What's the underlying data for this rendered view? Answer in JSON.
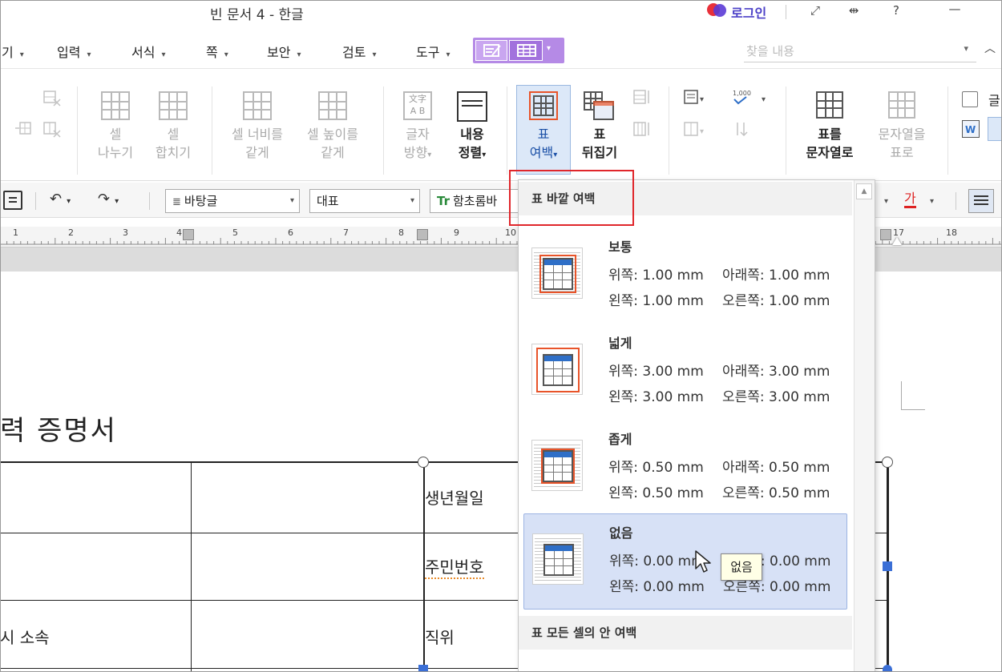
{
  "window": {
    "title": "빈 문서 4 - 한글",
    "login_label": "로그인",
    "icons": [
      "fullscreen-icon",
      "resize-icon",
      "help-icon",
      "minimize-icon"
    ]
  },
  "menu": {
    "items": [
      {
        "label": "기",
        "caret": "▾"
      },
      {
        "label": "입력",
        "caret": "▾"
      },
      {
        "label": "서식",
        "caret": "▾"
      },
      {
        "label": "쪽",
        "caret": "▾"
      },
      {
        "label": "보안",
        "caret": "▾"
      },
      {
        "label": "검토",
        "caret": "▾"
      },
      {
        "label": "도구",
        "caret": "▾"
      }
    ],
    "find_placeholder": "찾을 내용"
  },
  "ribbon": {
    "split_cell": {
      "line1": "셀",
      "line2": "나누기"
    },
    "merge_cell": {
      "line1": "셀",
      "line2": "합치기"
    },
    "equal_width": {
      "line1": "셀 너비를",
      "line2": "같게"
    },
    "equal_height": {
      "line1": "셀 높이를",
      "line2": "같게"
    },
    "text_direction": {
      "line1": "글자",
      "line2": "방향"
    },
    "content_align": {
      "line1": "내용",
      "line2": "정렬"
    },
    "table_margin": {
      "line1": "표",
      "line2": "여백"
    },
    "table_flip": {
      "line1": "표",
      "line2": "뒤집기"
    },
    "table_to_text": {
      "line1": "표를",
      "line2": "문자열로"
    },
    "text_to_table": {
      "line1": "문자열을",
      "line2": "표로"
    },
    "cutoff_label": "글"
  },
  "format_bar": {
    "style": "바탕글",
    "font_lang": "대표",
    "font_name": "함초롬바",
    "font_color_label": "가"
  },
  "ruler": {
    "numbers": [
      "1",
      "2",
      "3",
      "4",
      "5",
      "6",
      "7",
      "8",
      "9",
      "10",
      "17",
      "18"
    ]
  },
  "document": {
    "title": "력  증명서",
    "cells": {
      "birth": "생년월일",
      "resident_no": "주민번호",
      "position": "직위",
      "affiliation": "시  소속"
    }
  },
  "dropdown": {
    "outer_header": "표 바깥 여백",
    "inner_header": "표 모든 셀의 안 여백",
    "tooltip": "없음",
    "options": [
      {
        "name": "보통",
        "top": "위쪽: 1.00 mm",
        "bottom": "아래쪽: 1.00 mm",
        "left": "왼쪽: 1.00 mm",
        "right": "오른쪽: 1.00 mm"
      },
      {
        "name": "넓게",
        "top": "위쪽: 3.00 mm",
        "bottom": "아래쪽: 3.00 mm",
        "left": "왼쪽: 3.00 mm",
        "right": "오른쪽: 3.00 mm"
      },
      {
        "name": "좁게",
        "top": "위쪽: 0.50 mm",
        "bottom": "아래쪽: 0.50 mm",
        "left": "왼쪽: 0.50 mm",
        "right": "오른쪽: 0.50 mm"
      },
      {
        "name": "없음",
        "top": "위쪽: 0.00 mm",
        "bottom": "아래쪽: 0.00 mm",
        "left": "왼쪽: 0.00 mm",
        "right": "오른쪽: 0.00 mm"
      }
    ],
    "selected": "없음"
  },
  "colors": {
    "accent_purple": "#b58ae6",
    "selection_blue": "#d7e1f6",
    "highlight_red": "#e0262b",
    "margin_marker": "#e8542a"
  }
}
